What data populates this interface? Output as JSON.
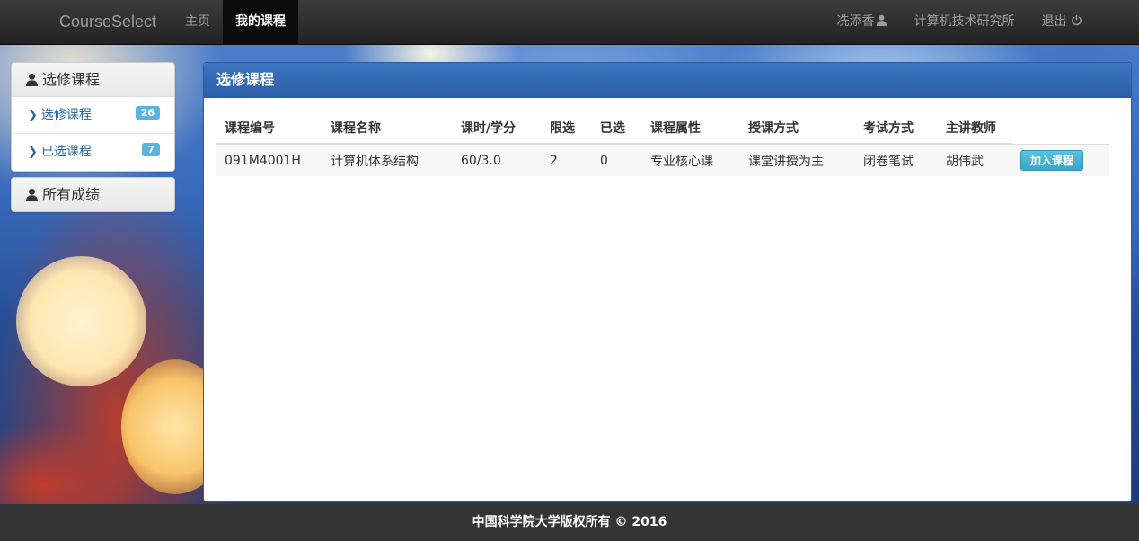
{
  "navbar": {
    "brand": "CourseSelect",
    "items": [
      {
        "label": "主页"
      },
      {
        "label": "我的课程"
      }
    ],
    "user_name": "冼添香",
    "department": "计算机技术研究所",
    "logout": "退出"
  },
  "sidebar": {
    "section1_title": "选修课程",
    "items": [
      {
        "label": "选修课程",
        "count": "26"
      },
      {
        "label": "已选课程",
        "count": "7"
      }
    ],
    "section2_title": "所有成绩"
  },
  "main": {
    "title": "选修课程",
    "columns": [
      "课程编号",
      "课程名称",
      "课时/学分",
      "限选",
      "已选",
      "课程属性",
      "授课方式",
      "考试方式",
      "主讲教师"
    ],
    "rows": [
      {
        "code": "091M4001H",
        "name": "计算机体系结构",
        "hours_credits": "60/3.0",
        "limit": "2",
        "selected": "0",
        "attribute": "专业核心课",
        "teaching_method": "课堂讲授为主",
        "exam_method": "闭卷笔试",
        "teacher": "胡伟武",
        "action_label": "加入课程"
      }
    ]
  },
  "footer": {
    "text": "中国科学院大学版权所有 © 2016"
  },
  "colors": {
    "navbar": "#222222",
    "panel_heading": "#2c5ea8",
    "badge": "#5bb4dd",
    "button": "#39a6cc",
    "footer": "#343434"
  }
}
